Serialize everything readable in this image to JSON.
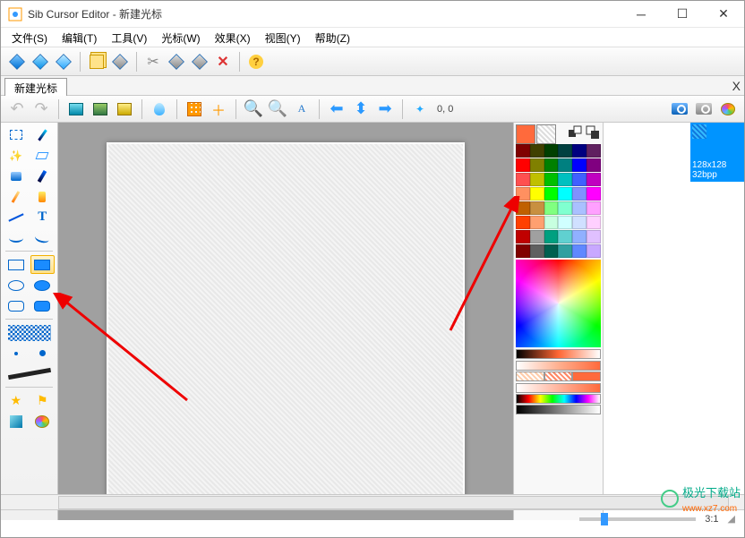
{
  "app": {
    "title": "Sib Cursor Editor - 新建光标"
  },
  "menu": {
    "file": "文件(S)",
    "edit": "编辑(T)",
    "tools": "工具(V)",
    "cursor": "光标(W)",
    "effects": "效果(X)",
    "view": "视图(Y)",
    "help": "帮助(Z)"
  },
  "tabs": {
    "doc1": "新建光标",
    "close": "X"
  },
  "coords": {
    "label": "0, 0"
  },
  "thumb": {
    "size": "128x128",
    "bpp": "32bpp"
  },
  "status": {
    "ratio": "3:1"
  },
  "palette_rows": [
    [
      "#800000",
      "#404000",
      "#004000",
      "#004040",
      "#000080",
      "#602060"
    ],
    [
      "#ff0000",
      "#808000",
      "#008000",
      "#008080",
      "#0000ff",
      "#800080"
    ],
    [
      "#ff5050",
      "#c0c000",
      "#00c000",
      "#00c0c0",
      "#4060ff",
      "#c000c0"
    ],
    [
      "#ff9060",
      "#ffff00",
      "#00ff00",
      "#00ffff",
      "#8090ff",
      "#ff00ff"
    ],
    [
      "#c06000",
      "#c89040",
      "#80ff80",
      "#80ffd0",
      "#aac0ff",
      "#ffa0ff"
    ],
    [
      "#ff4000",
      "#ffa070",
      "#c8ffe0",
      "#d0ffff",
      "#d0e0ff",
      "#ffd0ff"
    ],
    [
      "#c00000",
      "#a0a0a0",
      "#00a080",
      "#60d0d0",
      "#90b0ff",
      "#e0c0ff"
    ],
    [
      "#800000",
      "#606060",
      "#006050",
      "#30a0a0",
      "#6088ff",
      "#c8a8ff"
    ]
  ],
  "current_colors": {
    "fg": "#ff6a3c",
    "bg_pattern": "hatch"
  },
  "watermark": {
    "text": "极光下载站",
    "url": "www.xz7.com"
  }
}
